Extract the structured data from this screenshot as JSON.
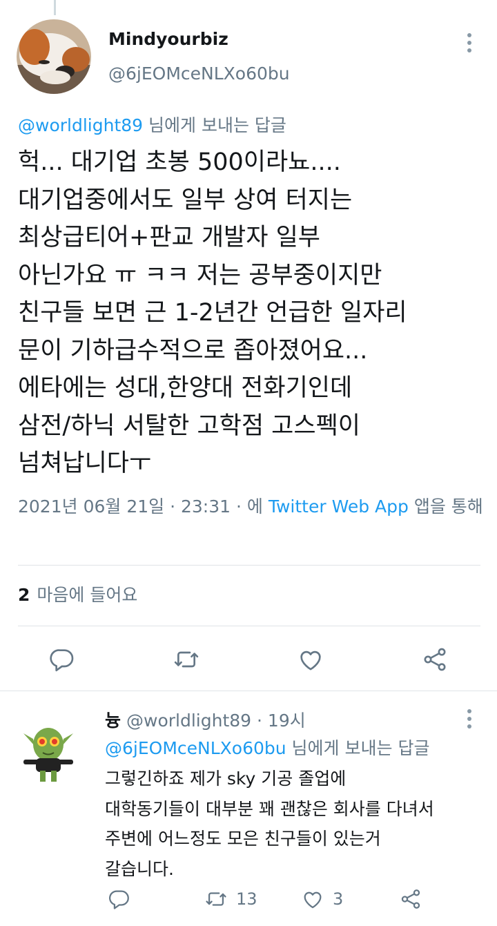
{
  "main_tweet": {
    "display_name": "Mindyourbiz",
    "handle": "@6jEOMceNLXo60bu",
    "reply_to_handle": "@worldlight89",
    "reply_to_suffix": " 님에게 보내는 답글",
    "text": "헉... 대기업 초봉 500이라뇨....\n대기업중에서도 일부 상여 터지는\n최상급티어+판교 개발자 일부\n아닌가요 ㅠ ㅋㅋ 저는 공부중이지만\n친구들 보면 근 1-2년간 언급한 일자리\n문이 기하급수적으로 좁아졌어요...\n에타에는 성대,한양대 전화기인데\n삼전/하닉 서탈한 고학점 고스펙이\n넘쳐납니다ㅜ",
    "timestamp": "2021년 06월 21일 · 23:31 · 에",
    "client": "Twitter Web App",
    "client_suffix": "앱을 통해",
    "like_count": "2",
    "like_label": "마음에 들어요"
  },
  "reply_tweet": {
    "display_name": "늉",
    "handle": "@worldlight89",
    "time": "· 19시",
    "reply_to_handle": "@6jEOMceNLXo60bu",
    "reply_to_suffix": " 님에게 보내는 답글",
    "text": "그렇긴하죠 제가 sky 기공 졸업에\n대학동기들이 대부분 꽤 괜찮은 회사를 다녀서\n주변에 어느정도 모은 친구들이 있는거\n갈습니다.",
    "retweet_count": "13",
    "like_count": "3"
  },
  "icons": {
    "more": "more-vertical-icon",
    "reply": "reply-icon",
    "retweet": "retweet-icon",
    "like": "heart-icon",
    "share": "share-icon"
  },
  "colors": {
    "accent": "#1d9bf0",
    "secondary_text": "#657786",
    "icon": "#657786",
    "divider": "#dfe3e7"
  }
}
